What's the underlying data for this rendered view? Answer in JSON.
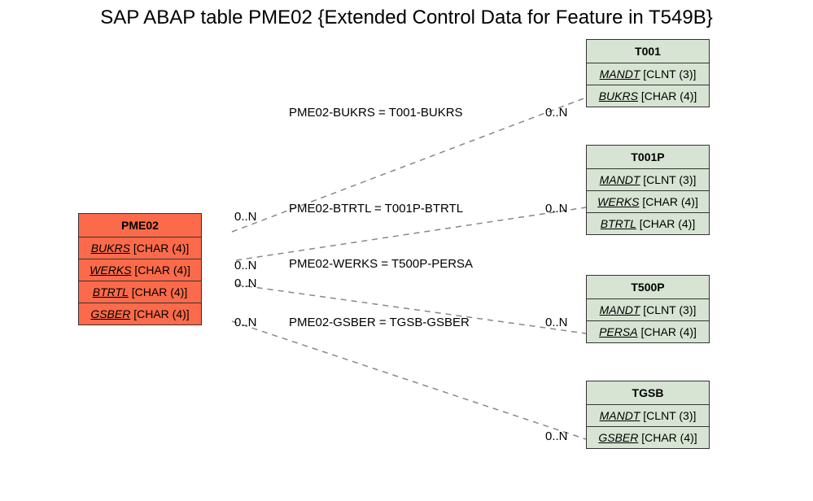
{
  "title": "SAP ABAP table PME02 {Extended Control Data for Feature in T549B}",
  "source": {
    "name": "PME02",
    "fields": [
      {
        "name": "BUKRS",
        "type": "[CHAR (4)]"
      },
      {
        "name": "WERKS",
        "type": "[CHAR (4)]"
      },
      {
        "name": "BTRTL",
        "type": "[CHAR (4)]"
      },
      {
        "name": "GSBER",
        "type": "[CHAR (4)]"
      }
    ]
  },
  "targets": [
    {
      "name": "T001",
      "fields": [
        {
          "name": "MANDT",
          "type": "[CLNT (3)]"
        },
        {
          "name": "BUKRS",
          "type": "[CHAR (4)]"
        }
      ]
    },
    {
      "name": "T001P",
      "fields": [
        {
          "name": "MANDT",
          "type": "[CLNT (3)]"
        },
        {
          "name": "WERKS",
          "type": "[CHAR (4)]"
        },
        {
          "name": "BTRTL",
          "type": "[CHAR (4)]"
        }
      ]
    },
    {
      "name": "T500P",
      "fields": [
        {
          "name": "MANDT",
          "type": "[CLNT (3)]"
        },
        {
          "name": "PERSA",
          "type": "[CHAR (4)]"
        }
      ]
    },
    {
      "name": "TGSB",
      "fields": [
        {
          "name": "MANDT",
          "type": "[CLNT (3)]"
        },
        {
          "name": "GSBER",
          "type": "[CHAR (4)]"
        }
      ]
    }
  ],
  "relations": [
    {
      "label": "PME02-BUKRS = T001-BUKRS",
      "src_card": "0..N",
      "dst_card": "0..N"
    },
    {
      "label": "PME02-BTRTL = T001P-BTRTL",
      "src_card": "0..N",
      "dst_card": "0..N"
    },
    {
      "label": "PME02-WERKS = T500P-PERSA",
      "src_card": "0..N",
      "dst_card": ""
    },
    {
      "label": "PME02-GSBER = TGSB-GSBER",
      "src_card": "0..N",
      "dst_card": "0..N"
    }
  ],
  "extra_card": "0..N"
}
